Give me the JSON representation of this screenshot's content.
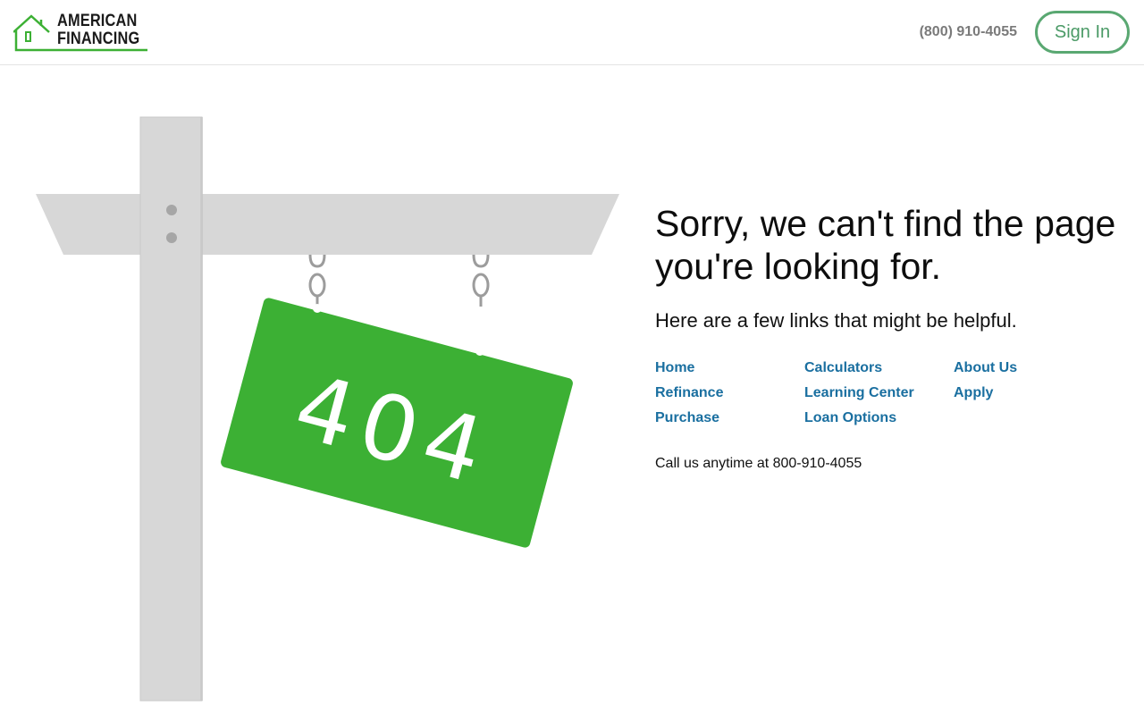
{
  "brand": {
    "name_line1": "AMERICAN",
    "name_line2": "FINANCING",
    "accent_color": "#3cb034"
  },
  "header": {
    "phone": "(800) 910-4055",
    "signin_label": "Sign In"
  },
  "sign": {
    "code": "404"
  },
  "main": {
    "headline": "Sorry, we can't find the page you're looking for.",
    "subline": "Here are a few links that might be helpful.",
    "links": [
      [
        "Home",
        "Calculators",
        "About Us"
      ],
      [
        "Refinance",
        "Learning Center",
        "Apply"
      ],
      [
        "Purchase",
        "Loan Options"
      ]
    ],
    "call_text": "Call us anytime at 800-910-4055"
  }
}
